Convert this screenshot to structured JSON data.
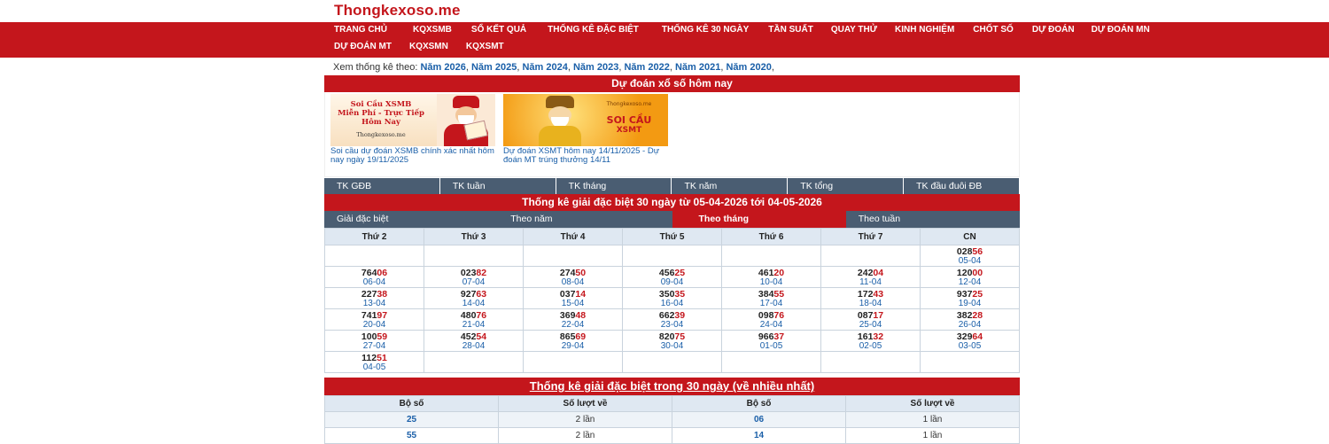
{
  "site": {
    "logo": "Thongkexoso.me"
  },
  "nav": {
    "row1": [
      "TRANG CHỦ",
      "KQXSMB",
      "SỔ KẾT QUẢ",
      "THỐNG KÊ ĐẶC BIỆT",
      "THỐNG KÊ 30 NGÀY",
      "TẦN SUẤT",
      "QUAY THỬ",
      "KINH NGHIỆM",
      "CHỐT SỐ",
      "DỰ ĐOÁN",
      "DỰ ĐOÁN MN"
    ],
    "row2": [
      "DỰ ĐOÁN MT",
      "KQXSMN",
      "KQXSMT"
    ]
  },
  "years": {
    "prefix": "Xem thống kê theo:",
    "items": [
      "Năm 2026",
      "Năm 2025",
      "Năm 2024",
      "Năm 2023",
      "Năm 2022",
      "Năm 2021",
      "Năm 2020"
    ]
  },
  "predict": {
    "title": "Dự đoán xổ số hôm nay",
    "cards": [
      {
        "img_line1": "Soi Cầu XSMB",
        "img_line2": "Miễn Phí - Trực Tiếp",
        "img_line3": "Hôm Nay",
        "img_site": "Thongkexoso.me",
        "caption": "Soi cầu dự đoán XSMB chính xác nhất hôm nay ngày 19/11/2025"
      },
      {
        "img_line1": "SOI CẦU",
        "img_line2": "XSMT",
        "img_line3": "",
        "img_site": "Thongkexoso.me",
        "caption": "Dự đoán XSMT hôm nay 14/11/2025 - Dự đoán MT trúng thưởng 14/11"
      }
    ]
  },
  "stat_tabs": [
    "TK GĐB",
    "TK tuần",
    "TK tháng",
    "TK năm",
    "TK tổng",
    "TK đầu đuôi ĐB"
  ],
  "special": {
    "title": "Thống kê giải đặc biệt 30 ngày từ 05-04-2026 tới 04-05-2026",
    "view_tabs": [
      "Giải đặc biệt",
      "Theo năm",
      "Theo tháng",
      "Theo tuần"
    ],
    "active_tab": 2,
    "days": [
      "Thứ 2",
      "Thứ 3",
      "Thứ 4",
      "Thứ 5",
      "Thứ 6",
      "Thứ 7",
      "CN"
    ],
    "rows": [
      [
        null,
        null,
        null,
        null,
        null,
        null,
        {
          "head": "028",
          "tail": "56",
          "date": "05-04"
        }
      ],
      [
        {
          "head": "764",
          "tail": "06",
          "date": "06-04"
        },
        {
          "head": "023",
          "tail": "82",
          "date": "07-04"
        },
        {
          "head": "274",
          "tail": "50",
          "date": "08-04"
        },
        {
          "head": "456",
          "tail": "25",
          "date": "09-04"
        },
        {
          "head": "461",
          "tail": "20",
          "date": "10-04"
        },
        {
          "head": "242",
          "tail": "04",
          "date": "11-04"
        },
        {
          "head": "120",
          "tail": "00",
          "date": "12-04"
        }
      ],
      [
        {
          "head": "227",
          "tail": "38",
          "date": "13-04"
        },
        {
          "head": "927",
          "tail": "63",
          "date": "14-04"
        },
        {
          "head": "037",
          "tail": "14",
          "date": "15-04"
        },
        {
          "head": "350",
          "tail": "35",
          "date": "16-04"
        },
        {
          "head": "384",
          "tail": "55",
          "date": "17-04"
        },
        {
          "head": "172",
          "tail": "43",
          "date": "18-04"
        },
        {
          "head": "937",
          "tail": "25",
          "date": "19-04"
        }
      ],
      [
        {
          "head": "741",
          "tail": "97",
          "date": "20-04"
        },
        {
          "head": "480",
          "tail": "76",
          "date": "21-04"
        },
        {
          "head": "369",
          "tail": "48",
          "date": "22-04"
        },
        {
          "head": "662",
          "tail": "39",
          "date": "23-04"
        },
        {
          "head": "098",
          "tail": "76",
          "date": "24-04"
        },
        {
          "head": "087",
          "tail": "17",
          "date": "25-04"
        },
        {
          "head": "382",
          "tail": "28",
          "date": "26-04"
        }
      ],
      [
        {
          "head": "100",
          "tail": "59",
          "date": "27-04"
        },
        {
          "head": "452",
          "tail": "54",
          "date": "28-04"
        },
        {
          "head": "865",
          "tail": "69",
          "date": "29-04"
        },
        {
          "head": "820",
          "tail": "75",
          "date": "30-04"
        },
        {
          "head": "966",
          "tail": "37",
          "date": "01-05"
        },
        {
          "head": "161",
          "tail": "32",
          "date": "02-05"
        },
        {
          "head": "329",
          "tail": "64",
          "date": "03-05"
        }
      ],
      [
        {
          "head": "112",
          "tail": "51",
          "date": "04-05"
        },
        null,
        null,
        null,
        null,
        null,
        null
      ]
    ]
  },
  "frequent": {
    "title": "Thống kê giải đặc biệt trong 30 ngày (về nhiều nhất)",
    "headers": [
      "Bộ số",
      "Số lượt về",
      "Bộ số",
      "Số lượt về"
    ],
    "rows": [
      [
        "25",
        "2 lần",
        "06",
        "1 lần"
      ],
      [
        "55",
        "2 lần",
        "14",
        "1 lần"
      ]
    ]
  }
}
